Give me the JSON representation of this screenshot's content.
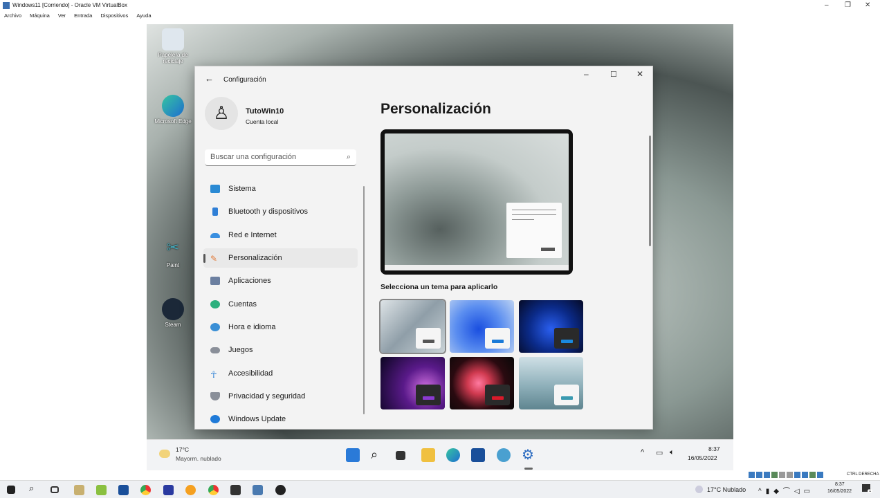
{
  "host": {
    "title": "Windows11 [Corriendo] - Oracle VM VirtualBox",
    "menu": [
      "Archivo",
      "Máquina",
      "Ver",
      "Entrada",
      "Dispositivos",
      "Ayuda"
    ],
    "status_label": "CTRL DERECHA",
    "taskbar": {
      "weather": "17°C  Nublado",
      "time": "8:37",
      "date": "16/05/2022",
      "notification_count": "1"
    }
  },
  "desktop": {
    "icons": [
      "Papelera de reciclaje",
      "Microsoft Edge",
      "Paint",
      "Steam"
    ]
  },
  "settings": {
    "title": "Configuración",
    "user_name": "TutoWin10",
    "account_type": "Cuenta local",
    "search_placeholder": "Buscar una configuración",
    "nav": [
      {
        "label": "Sistema",
        "color": "#2a8ad4"
      },
      {
        "label": "Bluetooth y dispositivos",
        "color": "#2f7fd6"
      },
      {
        "label": "Red e Internet",
        "color": "#3a8fe0"
      },
      {
        "label": "Personalización",
        "color": "#e07a3a"
      },
      {
        "label": "Aplicaciones",
        "color": "#6b7fa0"
      },
      {
        "label": "Cuentas",
        "color": "#2bb07d"
      },
      {
        "label": "Hora e idioma",
        "color": "#3a8fd6"
      },
      {
        "label": "Juegos",
        "color": "#8a8f99"
      },
      {
        "label": "Accesibilidad",
        "color": "#2a7fd4"
      },
      {
        "label": "Privacidad y seguridad",
        "color": "#8a8f99"
      },
      {
        "label": "Windows Update",
        "color": "#1f7ad8"
      }
    ],
    "selected": "Personalización",
    "page_title": "Personalización",
    "theme_heading": "Selecciona un tema para aplicarlo"
  },
  "vm_taskbar": {
    "weather_temp": "17°C",
    "weather_desc": "Mayorm. nublado",
    "time": "8:37",
    "date": "16/05/2022"
  }
}
